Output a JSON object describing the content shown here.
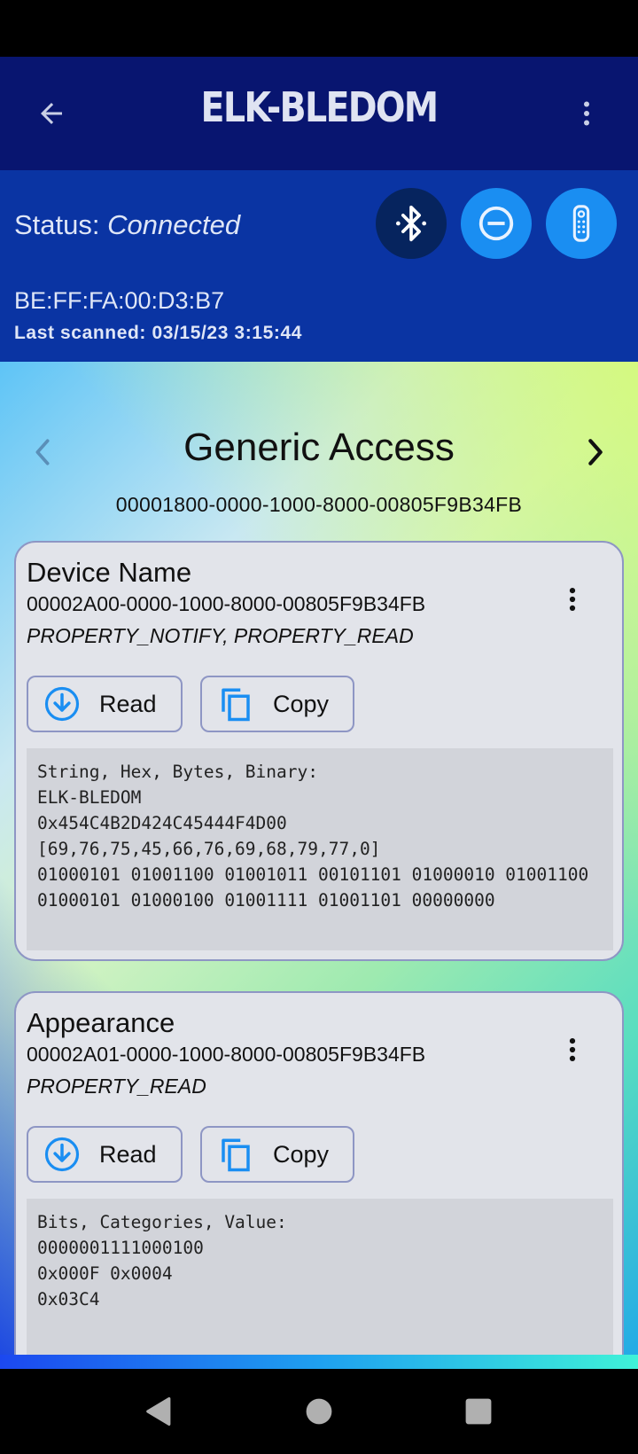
{
  "app_bar": {
    "title": "ELK-BLEDOM",
    "back_icon": "arrow-left-icon",
    "menu_icon": "more-vert-icon"
  },
  "device": {
    "status_label": "Status:",
    "status_value": "Connected",
    "mac": "BE:FF:FA:00:D3:B7",
    "last_scanned": "Last scanned: 03/15/23 3:15:44",
    "buttons": [
      "bluetooth-icon",
      "disconnect-icon",
      "remote-icon"
    ]
  },
  "service": {
    "name": "Generic Access",
    "uuid": "00001800-0000-1000-8000-00805F9B34FB"
  },
  "characteristics": [
    {
      "name": "Device Name",
      "uuid": "00002A00-0000-1000-8000-00805F9B34FB",
      "properties": "PROPERTY_NOTIFY, PROPERTY_READ",
      "read_label": "Read",
      "copy_label": "Copy",
      "value": "String, Hex, Bytes, Binary:\nELK-BLEDOM\n0x454C4B2D424C45444F4D00\n[69,76,75,45,66,76,69,68,79,77,0]\n01000101 01001100 01001011 00101101 01000010 01001100\n01000101 01000100 01001111 01001101 00000000"
    },
    {
      "name": "Appearance",
      "uuid": "00002A01-0000-1000-8000-00805F9B34FB",
      "properties": "PROPERTY_READ",
      "read_label": "Read",
      "copy_label": "Copy",
      "value": "Bits, Categories, Value:\n0000001111000100\n0x000F 0x0004\n0x03C4"
    }
  ],
  "colors": {
    "app_bar": "#081570",
    "device_panel": "#0a34a3",
    "accent": "#1a8ef2"
  }
}
